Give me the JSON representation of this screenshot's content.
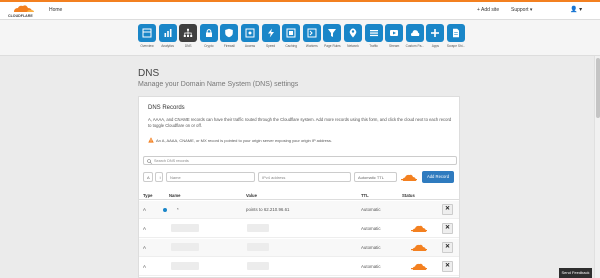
{
  "topbar": {
    "brand": "CLOUDFLARE",
    "home_label": "Home",
    "add_site_label": "+ Add site",
    "support_label": "Support ▾",
    "user_label": "👤 ▾"
  },
  "nav": {
    "items": [
      {
        "label": "Overview",
        "icon": "overview-icon"
      },
      {
        "label": "Analytics",
        "icon": "analytics-icon"
      },
      {
        "label": "DNS",
        "icon": "dns-icon"
      },
      {
        "label": "Crypto",
        "icon": "lock-icon"
      },
      {
        "label": "Firewall",
        "icon": "shield-icon"
      },
      {
        "label": "Access",
        "icon": "access-icon"
      },
      {
        "label": "Speed",
        "icon": "lightning-icon"
      },
      {
        "label": "Caching",
        "icon": "caching-icon"
      },
      {
        "label": "Workers",
        "icon": "workers-icon"
      },
      {
        "label": "Page Rules",
        "icon": "filter-icon"
      },
      {
        "label": "Network",
        "icon": "location-icon"
      },
      {
        "label": "Traffic",
        "icon": "traffic-icon"
      },
      {
        "label": "Stream",
        "icon": "stream-icon"
      },
      {
        "label": "Custom Pa...",
        "icon": "cloud-icon"
      },
      {
        "label": "Apps",
        "icon": "plus-icon"
      },
      {
        "label": "Scrape Shi...",
        "icon": "document-icon"
      }
    ],
    "active_index": 2,
    "accent": "#1a86c8",
    "active_color": "#404040"
  },
  "page": {
    "title": "DNS",
    "subtitle": "Manage your Domain Name System (DNS) settings"
  },
  "panel": {
    "title": "DNS Records",
    "description": "A, AAAA, and CNAME records can have their traffic routed through the Cloudflare system. Add more records using this form, and click the cloud next to each record to toggle Cloudflare on or off.",
    "warning": "An A, AAAA, CNAME, or MX record is pointed to your origin server exposing your origin IP address."
  },
  "search": {
    "placeholder": "Search DNS records"
  },
  "add_form": {
    "type_value": "A",
    "stepper_label": "↕",
    "name_placeholder": "Name",
    "ip_placeholder": "IPv4 address",
    "ttl_value": "Automatic TTL",
    "add_label": "Add Record"
  },
  "table": {
    "headers": {
      "type": "Type",
      "name": "Name",
      "value": "Value",
      "ttl": "TTL",
      "status": "Status"
    },
    "rows": [
      {
        "type": "A",
        "name": "*",
        "value": "points to 62.210.96.61",
        "ttl": "Automatic",
        "status": "dns-only",
        "delete": "✕"
      },
      {
        "type": "A",
        "name": "",
        "value": "",
        "ttl": "Automatic",
        "status": "proxied",
        "delete": "✕"
      },
      {
        "type": "A",
        "name": "",
        "value": "",
        "ttl": "Automatic",
        "status": "proxied",
        "delete": "✕"
      },
      {
        "type": "A",
        "name": "",
        "value": "",
        "ttl": "Automatic",
        "status": "proxied",
        "delete": "✕"
      }
    ]
  },
  "feedback_label": "Send Feedback",
  "colors": {
    "brand_orange": "#f38020",
    "button_blue": "#2f7bbf"
  }
}
